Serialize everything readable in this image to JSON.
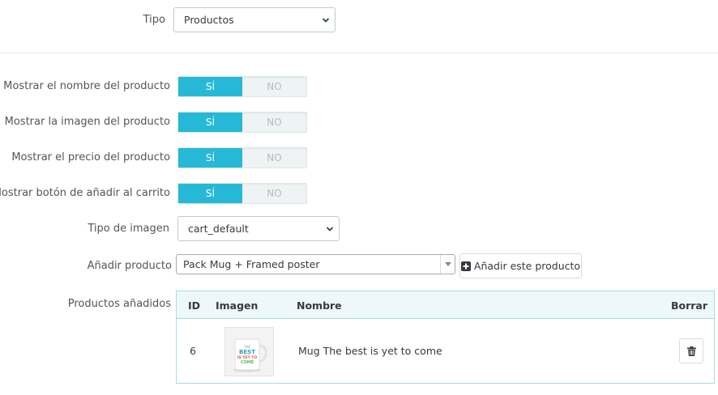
{
  "tipo": {
    "label": "Tipo",
    "value": "Productos"
  },
  "toggles": [
    {
      "label": "Mostrar el nombre del producto",
      "on": "SÍ",
      "off": "NO"
    },
    {
      "label": "Mostrar la imagen del producto",
      "on": "SÍ",
      "off": "NO"
    },
    {
      "label": "Mostrar el precio del producto",
      "on": "SÍ",
      "off": "NO"
    },
    {
      "label": "Mostrar botón de añadir al carrito",
      "on": "SÍ",
      "off": "NO"
    }
  ],
  "tipo_imagen": {
    "label": "Tipo de imagen",
    "value": "cart_default"
  },
  "anadir_producto": {
    "label": "Añadir producto",
    "value": "Pack Mug + Framed poster",
    "button": "Añadir este producto"
  },
  "productos_anadidos": {
    "label": "Productos añadidos",
    "columns": {
      "id": "ID",
      "imagen": "Imagen",
      "nombre": "Nombre",
      "borrar": "Borrar"
    },
    "rows": [
      {
        "id": "6",
        "nombre": "Mug The best is yet to come",
        "image_text": [
          "THE",
          "BEST",
          "IS YET TO",
          "COME"
        ]
      }
    ]
  },
  "colors": {
    "accent": "#25b9d7",
    "table_border": "#a9dbe6",
    "table_header_bg": "#eef8fb"
  }
}
